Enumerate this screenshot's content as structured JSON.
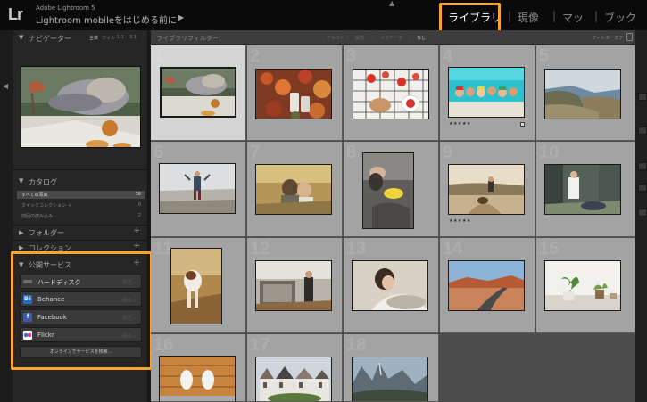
{
  "identity": {
    "logo": "Lr",
    "app_name": "Adobe Lightroom 5",
    "subtitle": "Lightroom mobileをはじめる前に",
    "subtitle_arrow": "▶",
    "top_caret": "▲"
  },
  "modules": [
    {
      "label": "ライブラリ",
      "active": true
    },
    {
      "label": "現像",
      "active": false
    },
    {
      "label": "マッ",
      "active": false
    },
    {
      "label": "ブック",
      "active": false
    }
  ],
  "module_separator": "|",
  "highlight_color": "#f7a431",
  "left_panel": {
    "navigator": {
      "title": "ナビゲーター",
      "zoom_options": [
        "全体",
        "フィル",
        "1:1",
        "3:1"
      ],
      "active_zoom": "全体"
    },
    "catalog": {
      "title": "カタログ",
      "items": [
        {
          "label": "すべての写真",
          "count": "18",
          "selected": true
        },
        {
          "label": "クイックコレクション ＋",
          "count": "0",
          "selected": false
        },
        {
          "label": "前回の読み込み",
          "count": "2",
          "selected": false
        }
      ]
    },
    "folders": {
      "title": "フォルダー",
      "add": "+"
    },
    "collections": {
      "title": "コレクション",
      "add": "+"
    },
    "publish": {
      "title": "公開サービス",
      "add": "+",
      "services": [
        {
          "name": "ハードディスク",
          "icon": "hard-drive-icon",
          "icon_color": "#6d6d6d",
          "setup": "設定..."
        },
        {
          "name": "Behance",
          "icon": "behance-icon",
          "icon_color": "#1c6fd1",
          "setup": "設定..."
        },
        {
          "name": "Facebook",
          "icon": "facebook-icon",
          "icon_color": "#3b5ca8",
          "setup": "設定..."
        },
        {
          "name": "Flickr",
          "icon": "flickr-icon",
          "icon_color": "#2a2a2a",
          "setup": "設定..."
        }
      ],
      "find_more": "オンラインでサービスを検索..."
    }
  },
  "filter_bar": {
    "title": "ライブラリフィルター：",
    "options": [
      {
        "label": "テキスト",
        "active": false
      },
      {
        "label": "属性",
        "active": false
      },
      {
        "label": "メタデータ",
        "active": false
      },
      {
        "label": "なし",
        "active": true
      }
    ],
    "right_label": "フィルターオフ"
  },
  "grid": {
    "photos": [
      {
        "num": "1",
        "subject": "cat-sleeping-on-pillow",
        "orientation": "landscape",
        "selected": true,
        "stars": ""
      },
      {
        "num": "2",
        "subject": "autumn-leaves-shoes",
        "orientation": "landscape",
        "selected": false,
        "stars": ""
      },
      {
        "num": "3",
        "subject": "strawberries-bread-on-grid",
        "orientation": "landscape",
        "selected": false,
        "stars": ""
      },
      {
        "num": "4",
        "subject": "children-in-pool",
        "orientation": "landscape",
        "selected": false,
        "stars": "★★★★★"
      },
      {
        "num": "5",
        "subject": "coastal-cliffs",
        "orientation": "landscape",
        "selected": false,
        "stars": ""
      },
      {
        "num": "6",
        "subject": "hiker-in-winter-field",
        "orientation": "landscape",
        "selected": false,
        "stars": ""
      },
      {
        "num": "7",
        "subject": "couple-in-golden-grass",
        "orientation": "landscape",
        "selected": false,
        "stars": ""
      },
      {
        "num": "8",
        "subject": "dog-with-yellow-frisbee",
        "orientation": "square",
        "selected": false,
        "stars": ""
      },
      {
        "num": "9",
        "subject": "dog-on-trail",
        "orientation": "landscape",
        "selected": false,
        "stars": "★★★★★"
      },
      {
        "num": "10",
        "subject": "woman-in-forest",
        "orientation": "landscape",
        "selected": false,
        "stars": ""
      },
      {
        "num": "11",
        "subject": "pointer-dog-in-grass",
        "orientation": "portrait",
        "selected": false,
        "stars": ""
      },
      {
        "num": "12",
        "subject": "man-on-balcony",
        "orientation": "landscape",
        "selected": false,
        "stars": ""
      },
      {
        "num": "13",
        "subject": "woman-portrait-lying",
        "orientation": "landscape",
        "selected": false,
        "stars": ""
      },
      {
        "num": "14",
        "subject": "desert-road",
        "orientation": "landscape",
        "selected": false,
        "stars": ""
      },
      {
        "num": "15",
        "subject": "potted-plants-window",
        "orientation": "landscape",
        "selected": false,
        "stars": ""
      },
      {
        "num": "16",
        "subject": "feet-on-wood-floor",
        "orientation": "landscape",
        "selected": false,
        "stars": ""
      },
      {
        "num": "17",
        "subject": "painted-ladies-houses",
        "orientation": "landscape",
        "selected": false,
        "stars": ""
      },
      {
        "num": "18",
        "subject": "yosemite-valley",
        "orientation": "landscape",
        "selected": false,
        "stars": ""
      }
    ]
  }
}
